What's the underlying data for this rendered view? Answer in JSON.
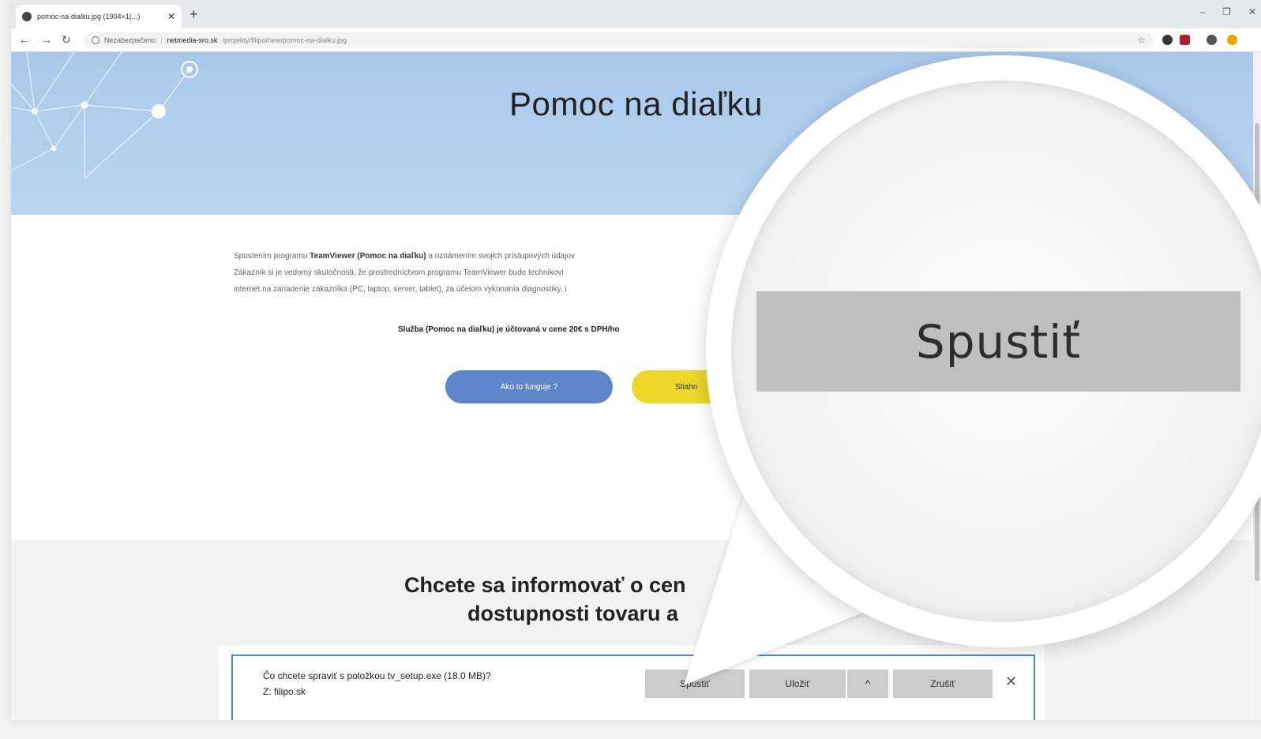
{
  "browser": {
    "tab_title": "pomoc-na-dialku.jpg (1904×1(...)",
    "tab_close": "✕",
    "new_tab": "+",
    "window_controls": {
      "minimize": "–",
      "maximize": "❐",
      "close": "✕"
    },
    "nav": {
      "back": "←",
      "forward": "→",
      "reload": "↻"
    },
    "security_label": "Nezabezpečeno",
    "url_host": "netmedia-sro.sk",
    "url_path": "/projekty/filipo/new/pomoc-na-dialku.jpg",
    "bookmark_icon": "star-icon",
    "extensions": [
      {
        "name": "extension-circle-icon",
        "color": "#333333"
      },
      {
        "name": "extension-red-icon",
        "color": "#b01c2e"
      },
      {
        "name": "account-icon",
        "color": "#555555"
      },
      {
        "name": "extension-orange-icon",
        "color": "#f0a000"
      }
    ]
  },
  "hero": {
    "title": "Pomoc na diaľku"
  },
  "content": {
    "paragraph_lines": [
      {
        "prefix": "Spustením programu ",
        "bold": "TeamViewer (Pomoc na diaľku)",
        "suffix": " a oznámením svojich prístupových údajov"
      },
      {
        "prefix": "Zákazník si je vedomý skutočnosti, že prostredníctvom programu TeamViewer bude technikovi",
        "bold": "",
        "suffix": ""
      },
      {
        "prefix": "internet na zariadenie zákazníka (PC, laptop, server, tablet), za účelom vykonania diagnostiky, i",
        "bold": "",
        "suffix": ""
      }
    ],
    "price_note": "Služba (Pomoc na diaľku) je účtovaná v cene 20€ s DPH/ho",
    "how_button": "Ako to funguje ?",
    "download_button": "Stiahn"
  },
  "section2": {
    "line1": "Chcete sa informovať o cen",
    "line2": "dostupnosti tovaru a"
  },
  "download_bar": {
    "question": "Čo chcete spraviť s položkou tv_setup.exe (18.0 MB)?",
    "from": "Z: filipo.sk",
    "run_label": "Spustiť",
    "save_label": "Uložiť",
    "expand_icon": "chevron-up-icon",
    "cancel_label": "Zrušiť",
    "close_label": "✕"
  },
  "magnifier": {
    "button_label": "Spustiť"
  },
  "colors": {
    "hero_bg": "#b3cfef",
    "primary_button": "#5f85ca",
    "download_button": "#efd62a",
    "download_frame": "#3e8fd8",
    "magnified_button": "#bfbfbf"
  }
}
